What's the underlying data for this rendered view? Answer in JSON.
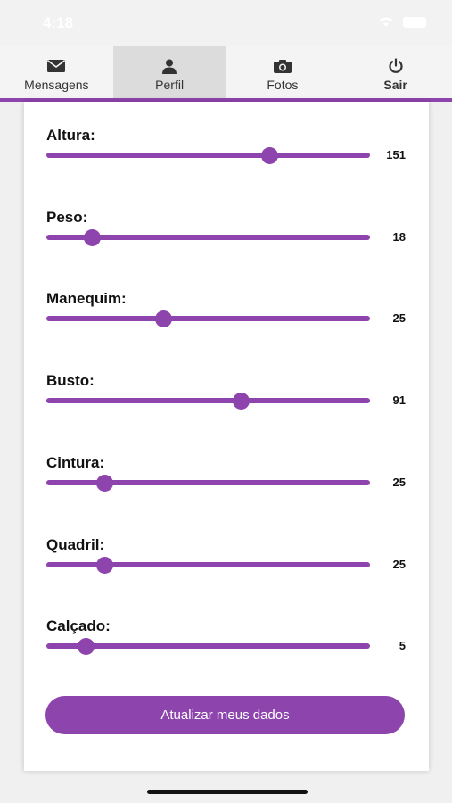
{
  "status_bar": {
    "time": "4:18"
  },
  "tabs": [
    {
      "label": "Mensagens",
      "icon": "envelope-icon",
      "active": false,
      "bold": false
    },
    {
      "label": "Perfil",
      "icon": "user-icon",
      "active": true,
      "bold": false
    },
    {
      "label": "Fotos",
      "icon": "camera-icon",
      "active": false,
      "bold": false
    },
    {
      "label": "Sair",
      "icon": "power-icon",
      "active": false,
      "bold": true
    }
  ],
  "accent_color": "#8e44ad",
  "sliders": [
    {
      "label": "Altura:",
      "value": "151",
      "level": 0.69
    },
    {
      "label": "Peso:",
      "value": "18",
      "level": 0.14
    },
    {
      "label": "Manequim:",
      "value": "25",
      "level": 0.36
    },
    {
      "label": "Busto:",
      "value": "91",
      "level": 0.6
    },
    {
      "label": "Cintura:",
      "value": "25",
      "level": 0.18
    },
    {
      "label": "Quadril:",
      "value": "25",
      "level": 0.18
    },
    {
      "label": "Calçado:",
      "value": "5",
      "level": 0.12
    }
  ],
  "update_button_label": "Atualizar meus dados"
}
